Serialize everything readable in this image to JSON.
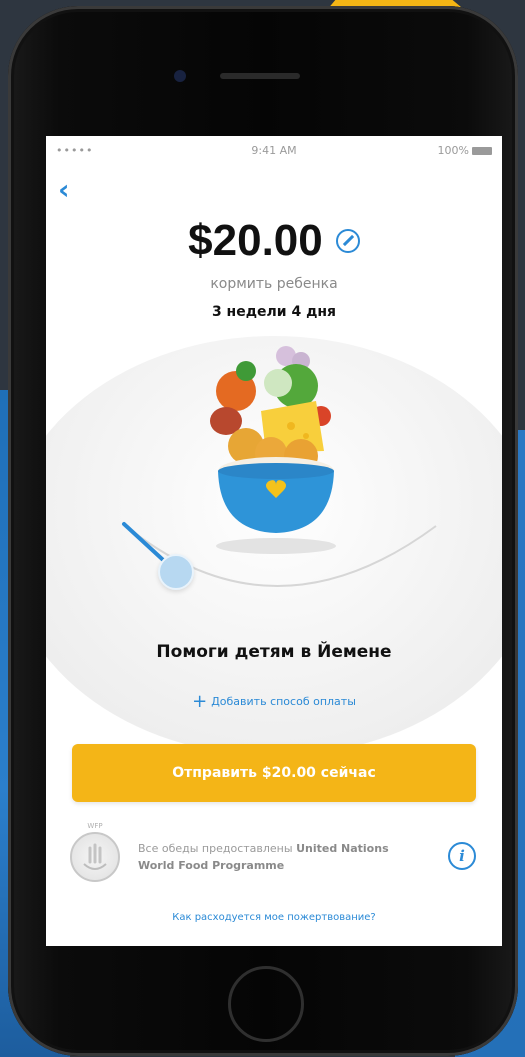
{
  "status_bar": {
    "signal": "•••••",
    "time": "9:41 AM",
    "battery": "100%"
  },
  "donation": {
    "amount": "$20.00",
    "subtitle": "кормить ребенка",
    "duration": "3 недели 4 дня"
  },
  "slider": {
    "value_fraction": 0.08
  },
  "cause": "Помоги детям в Йемене",
  "add_payment": "Добавить способ оплаты",
  "donate_button": "Отправить $20.00 сейчас",
  "wfp_logo_text": "WFP",
  "credit": {
    "prefix": "Все обеды предоставлены",
    "org": "United Nations World Food Programme"
  },
  "how_spent": "Как расходуется мое пожертвование?",
  "colors": {
    "accent": "#2b8ad6",
    "button": "#f4b517"
  }
}
